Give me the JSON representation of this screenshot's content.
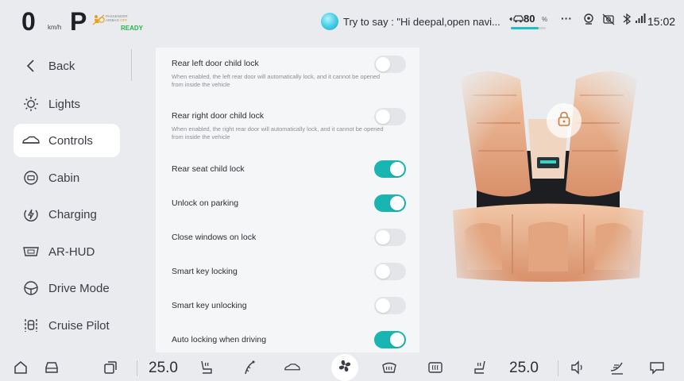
{
  "status_bar": {
    "speed": "0",
    "speed_unit": "km/h",
    "gear": "P",
    "airbag_line1": "PASSENGER",
    "airbag_line2": "AIRBAG",
    "airbag_state": "OFF",
    "ready": "READY",
    "assistant_hint": "Try to say : \"Hi deepal,open navi...",
    "battery_percent": "80",
    "battery_unit": "%",
    "battery_level": 0.8,
    "more": "···",
    "time": "15:02"
  },
  "sidebar": {
    "items": [
      {
        "label": "Back",
        "icon": "chevron-left-icon",
        "active": false
      },
      {
        "label": "Lights",
        "icon": "lights-icon",
        "active": false
      },
      {
        "label": "Controls",
        "icon": "car-icon",
        "active": true
      },
      {
        "label": "Cabin",
        "icon": "cabin-icon",
        "active": false
      },
      {
        "label": "Charging",
        "icon": "charging-icon",
        "active": false
      },
      {
        "label": "AR-HUD",
        "icon": "hud-icon",
        "active": false
      },
      {
        "label": "Drive Mode",
        "icon": "steering-wheel-icon",
        "active": false
      },
      {
        "label": "Cruise Pilot",
        "icon": "cruise-pilot-icon",
        "active": false
      }
    ]
  },
  "settings": [
    {
      "title": "Rear left door child lock",
      "description": "When enabled, the left rear door will automatically lock, and it cannot be opened from inside the vehicle",
      "enabled": false
    },
    {
      "title": "Rear right door child lock",
      "description": "When enabled, the right rear door will automatically lock, and it cannot be opened from inside the vehicle",
      "enabled": false
    },
    {
      "title": "Rear seat child lock",
      "description": "",
      "enabled": true
    },
    {
      "title": "Unlock on parking",
      "description": "",
      "enabled": true
    },
    {
      "title": "Close windows on lock",
      "description": "",
      "enabled": false
    },
    {
      "title": "Smart key locking",
      "description": "",
      "enabled": false
    },
    {
      "title": "Smart key unlocking",
      "description": "",
      "enabled": false
    },
    {
      "title": "Auto locking when driving",
      "description": "",
      "enabled": true
    }
  ],
  "dock": {
    "left_temp": "25.0",
    "right_temp": "25.0",
    "icons": [
      "home-icon",
      "car-icon",
      "apps-icon",
      "seat-heat-icon",
      "wiper-icon",
      "car-outline-icon",
      "fan-icon",
      "front-defrost-icon",
      "rear-defrost-icon",
      "seat-heat-right-icon",
      "volume-icon",
      "airflow-icon",
      "message-icon"
    ]
  },
  "colors": {
    "accent": "#19b5b0",
    "background": "#e9ebee",
    "panel": "#f5f6f7",
    "ready": "#2bb24c",
    "airbag_off": "#e8a01a"
  }
}
